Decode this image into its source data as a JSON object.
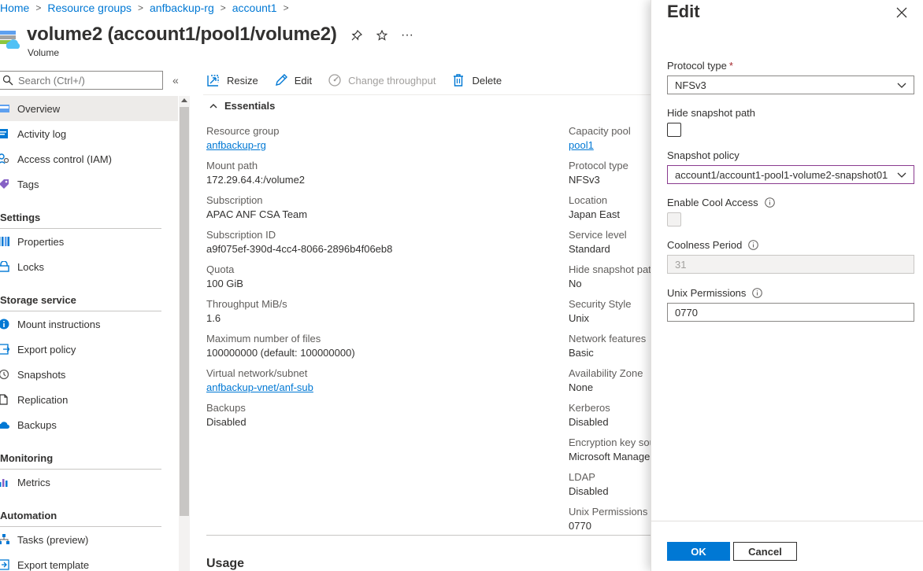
{
  "breadcrumb": {
    "items": [
      "Home",
      "Resource groups",
      "anfbackup-rg",
      "account1"
    ],
    "separator": ">"
  },
  "header": {
    "title": "volume2 (account1/pool1/volume2)",
    "subtitle": "Volume",
    "more": "···"
  },
  "sidebar": {
    "search_placeholder": "Search (Ctrl+/)",
    "collapse": "«",
    "items": [
      {
        "label": "Overview",
        "icon": "overview-icon"
      },
      {
        "label": "Activity log",
        "icon": "activity-log-icon"
      },
      {
        "label": "Access control (IAM)",
        "icon": "iam-icon"
      },
      {
        "label": "Tags",
        "icon": "tag-icon"
      }
    ],
    "settings_header": "Settings",
    "settings": [
      {
        "label": "Properties",
        "icon": "properties-icon"
      },
      {
        "label": "Locks",
        "icon": "lock-icon"
      }
    ],
    "storage_header": "Storage service",
    "storage": [
      {
        "label": "Mount instructions",
        "icon": "info-icon"
      },
      {
        "label": "Export policy",
        "icon": "export-policy-icon"
      },
      {
        "label": "Snapshots",
        "icon": "snapshot-icon"
      },
      {
        "label": "Replication",
        "icon": "replication-icon"
      },
      {
        "label": "Backups",
        "icon": "backup-icon"
      }
    ],
    "monitoring_header": "Monitoring",
    "monitoring": [
      {
        "label": "Metrics",
        "icon": "metrics-icon"
      }
    ],
    "automation_header": "Automation",
    "automation": [
      {
        "label": "Tasks (preview)",
        "icon": "tasks-icon"
      },
      {
        "label": "Export template",
        "icon": "export-template-icon"
      }
    ]
  },
  "toolbar": {
    "resize": "Resize",
    "edit": "Edit",
    "change_throughput": "Change throughput",
    "delete": "Delete"
  },
  "essentials": {
    "title": "Essentials",
    "left": [
      {
        "label": "Resource group",
        "value": "anfbackup-rg",
        "link": true
      },
      {
        "label": "Mount path",
        "value": "172.29.64.4:/volume2",
        "link": false
      },
      {
        "label": "Subscription",
        "value": "APAC ANF CSA Team",
        "link": false
      },
      {
        "label": "Subscription ID",
        "value": "a9f075ef-390d-4cc4-8066-2896b4f06eb8",
        "link": false
      },
      {
        "label": "Quota",
        "value": "100 GiB",
        "link": false
      },
      {
        "label": "Throughput MiB/s",
        "value": "1.6",
        "link": false
      },
      {
        "label": "Maximum number of files",
        "value": "100000000 (default: 100000000)",
        "link": false
      },
      {
        "label": "Virtual network/subnet",
        "value": "anfbackup-vnet/anf-sub",
        "link": true
      },
      {
        "label": "Backups",
        "value": "Disabled",
        "link": false
      }
    ],
    "right": [
      {
        "label": "Capacity pool",
        "value": "pool1",
        "link": true
      },
      {
        "label": "Protocol type",
        "value": "NFSv3",
        "link": false
      },
      {
        "label": "Location",
        "value": "Japan East",
        "link": false
      },
      {
        "label": "Service level",
        "value": "Standard",
        "link": false
      },
      {
        "label": "Hide snapshot pat",
        "value": "No",
        "link": false
      },
      {
        "label": "Security Style",
        "value": "Unix",
        "link": false
      },
      {
        "label": "Network features",
        "value": "Basic",
        "link": false
      },
      {
        "label": "Availability Zone",
        "value": "None",
        "link": false
      },
      {
        "label": "Kerberos",
        "value": "Disabled",
        "link": false
      },
      {
        "label": "Encryption key sou",
        "value": "Microsoft Manage",
        "link": false
      },
      {
        "label": "LDAP",
        "value": "Disabled",
        "link": false
      },
      {
        "label": "Unix Permissions",
        "value": "0770",
        "link": false
      }
    ]
  },
  "usage": {
    "title": "Usage"
  },
  "panel": {
    "title": "Edit",
    "protocol_label": "Protocol type",
    "required_mark": "*",
    "protocol_value": "NFSv3",
    "hide_snapshot_label": "Hide snapshot path",
    "snapshot_policy_label": "Snapshot policy",
    "snapshot_policy_value": "account1/account1-pool1-volume2-snapshot01",
    "cool_access_label": "Enable Cool Access",
    "coolness_label": "Coolness Period",
    "coolness_value": "31",
    "unix_label": "Unix Permissions",
    "unix_value": "0770",
    "ok": "OK",
    "cancel": "Cancel"
  },
  "colors": {
    "accent": "#0078d4",
    "focus": "#8a3b8f",
    "required": "#a4262c"
  }
}
